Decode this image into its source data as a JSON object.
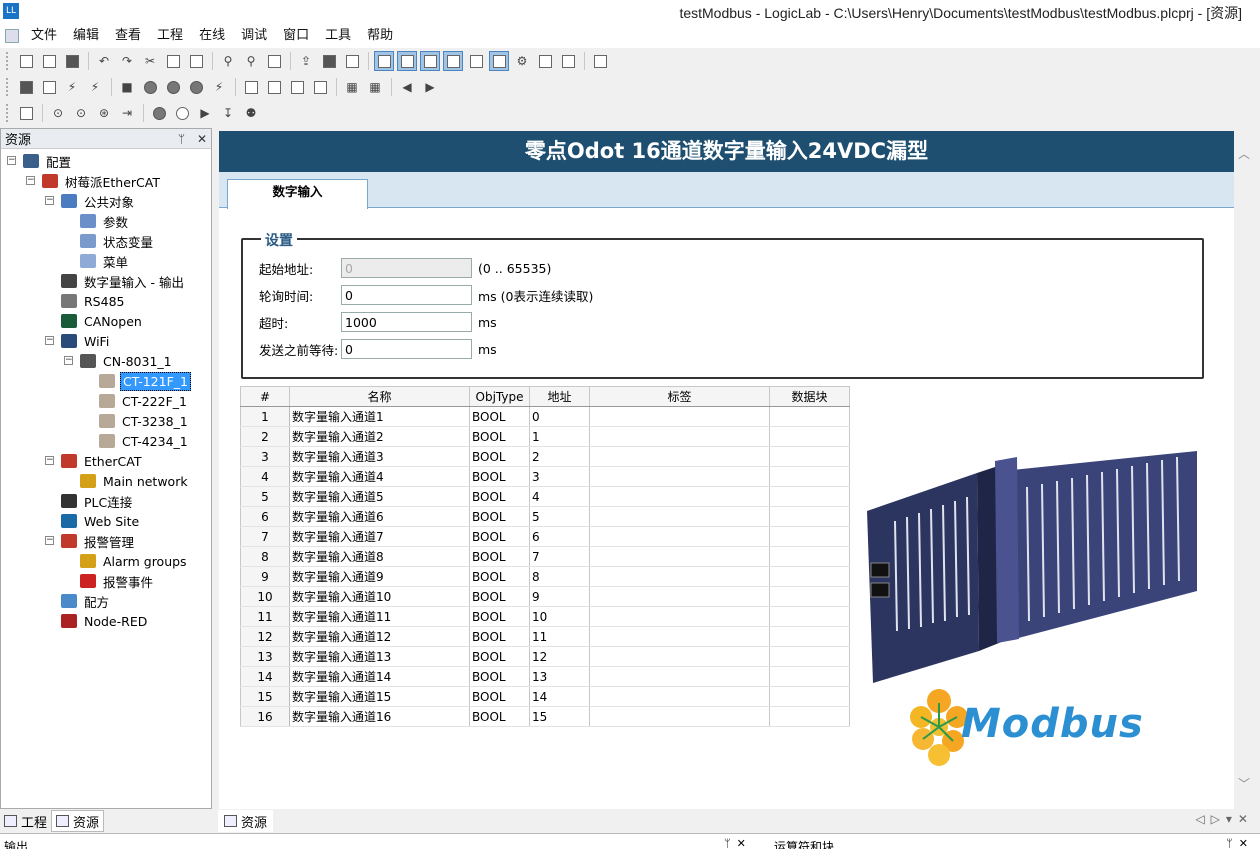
{
  "window": {
    "title": "testModbus - LogicLab - C:\\Users\\Henry\\Documents\\testModbus\\testModbus.plcprj - [资源]",
    "app_icon": "LL"
  },
  "menu": [
    "文件",
    "编辑",
    "查看",
    "工程",
    "在线",
    "调试",
    "窗口",
    "工具",
    "帮助"
  ],
  "left_panel": {
    "title": "资源",
    "pin": "ᛘ",
    "close": "✕"
  },
  "tree": [
    {
      "label": "配置",
      "icon": "config-icon",
      "color": "#3a5f8a"
    },
    {
      "label": "树莓派EtherCAT",
      "icon": "raspberry-icon",
      "color": "#c0392b"
    },
    {
      "label": "公共对象",
      "icon": "object-icon",
      "color": "#4a7cbf"
    },
    {
      "label": "参数",
      "icon": "param-icon",
      "color": "#6b8fc9"
    },
    {
      "label": "状态变量",
      "icon": "status-var-icon",
      "color": "#7a9acb"
    },
    {
      "label": "菜单",
      "icon": "menu-icon",
      "color": "#8faad6"
    },
    {
      "label": "数字量输入 - 输出",
      "icon": "digital-io-icon",
      "color": "#444444"
    },
    {
      "label": "RS485",
      "icon": "rs485-icon",
      "color": "#777777"
    },
    {
      "label": "CANopen",
      "icon": "canopen-icon",
      "color": "#1a5c3a"
    },
    {
      "label": "WiFi",
      "icon": "wifi-icon",
      "color": "#2a4a7a"
    },
    {
      "label": "CN-8031_1",
      "icon": "coupler-icon",
      "color": "#555555"
    },
    {
      "label": "CT-121F_1",
      "icon": "module-icon",
      "color": "#b8a898"
    },
    {
      "label": "CT-222F_1",
      "icon": "module-icon",
      "color": "#b8a898"
    },
    {
      "label": "CT-3238_1",
      "icon": "module-icon",
      "color": "#b8a898"
    },
    {
      "label": "CT-4234_1",
      "icon": "module-icon",
      "color": "#b8a898"
    },
    {
      "label": "EtherCAT",
      "icon": "ethercat-icon",
      "color": "#c0392b"
    },
    {
      "label": "Main network",
      "icon": "network-icon",
      "color": "#d4a017"
    },
    {
      "label": "PLC连接",
      "icon": "plc-link-icon",
      "color": "#333333"
    },
    {
      "label": "Web Site",
      "icon": "globe-icon",
      "color": "#1a6aa5"
    },
    {
      "label": "报警管理",
      "icon": "alarm-manager-icon",
      "color": "#c0392b"
    },
    {
      "label": "Alarm groups",
      "icon": "alarm-group-icon",
      "color": "#d4a017"
    },
    {
      "label": "报警事件",
      "icon": "alarm-event-icon",
      "color": "#cc2222"
    },
    {
      "label": "配方",
      "icon": "recipe-icon",
      "color": "#4a8ac8"
    },
    {
      "label": "Node-RED",
      "icon": "node-red-icon",
      "color": "#aa2222"
    }
  ],
  "bottom_tabs": [
    "工程",
    "资源"
  ],
  "main": {
    "banner": "零点Odot 16通道数字量输入24VDC漏型",
    "tab": "数字输入",
    "settings": {
      "legend": "设置",
      "start_address": {
        "label": "起始地址:",
        "value": "0",
        "suffix": "(0 .. 65535)"
      },
      "poll_time": {
        "label": "轮询时间:",
        "value": "0",
        "suffix": "ms   (0表示连续读取)"
      },
      "timeout": {
        "label": "超时:",
        "value": "1000",
        "suffix": "ms"
      },
      "wait_before_send": {
        "label": "发送之前等待:",
        "value": "0",
        "suffix": "ms"
      }
    },
    "grid": {
      "headers": [
        "#",
        "名称",
        "ObjType",
        "地址",
        "标签",
        "数据块"
      ],
      "rows": [
        [
          "1",
          "数字量输入通道1",
          "BOOL",
          "0",
          "",
          ""
        ],
        [
          "2",
          "数字量输入通道2",
          "BOOL",
          "1",
          "",
          ""
        ],
        [
          "3",
          "数字量输入通道3",
          "BOOL",
          "2",
          "",
          ""
        ],
        [
          "4",
          "数字量输入通道4",
          "BOOL",
          "3",
          "",
          ""
        ],
        [
          "5",
          "数字量输入通道5",
          "BOOL",
          "4",
          "",
          ""
        ],
        [
          "6",
          "数字量输入通道6",
          "BOOL",
          "5",
          "",
          ""
        ],
        [
          "7",
          "数字量输入通道7",
          "BOOL",
          "6",
          "",
          ""
        ],
        [
          "8",
          "数字量输入通道8",
          "BOOL",
          "7",
          "",
          ""
        ],
        [
          "9",
          "数字量输入通道9",
          "BOOL",
          "8",
          "",
          ""
        ],
        [
          "10",
          "数字量输入通道10",
          "BOOL",
          "9",
          "",
          ""
        ],
        [
          "11",
          "数字量输入通道11",
          "BOOL",
          "10",
          "",
          ""
        ],
        [
          "12",
          "数字量输入通道12",
          "BOOL",
          "11",
          "",
          ""
        ],
        [
          "13",
          "数字量输入通道13",
          "BOOL",
          "12",
          "",
          ""
        ],
        [
          "14",
          "数字量输入通道14",
          "BOOL",
          "13",
          "",
          ""
        ],
        [
          "15",
          "数字量输入通道15",
          "BOOL",
          "14",
          "",
          ""
        ],
        [
          "16",
          "数字量输入通道16",
          "BOOL",
          "15",
          "",
          ""
        ]
      ]
    },
    "logo_text": "Modbus"
  },
  "doc_tab": "资源",
  "output_bar": {
    "left": "输出",
    "right": "运算符和块"
  }
}
